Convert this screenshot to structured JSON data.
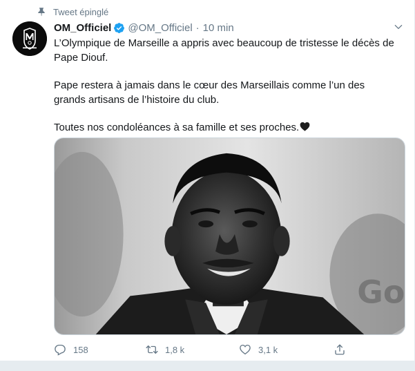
{
  "pinned": {
    "label": "Tweet épinglé",
    "icon": "pin-icon"
  },
  "author": {
    "name": "OM_Officiel",
    "handle": "@OM_Officiel",
    "separator": "·",
    "time": "10 min",
    "verified": true,
    "avatar": "om-logo-avatar"
  },
  "tweet": {
    "paragraphs": [
      "L’Olympique de Marseille a appris avec beaucoup de tristesse le décès de Pape Diouf.",
      "Pape restera à jamais dans le cœur des Marseillais comme l’un des grands artisans de l’histoire du club.",
      "Toutes nos condoléances à sa famille et ses proches."
    ],
    "emoji": "black-heart-icon"
  },
  "media": {
    "type": "photo",
    "style": "black-and-white portrait"
  },
  "actions": {
    "reply_count": "158",
    "retweet_count": "1,8 k",
    "like_count": "3,1 k"
  },
  "colors": {
    "text": "#14171a",
    "secondary": "#657786",
    "verified": "#1da1f2",
    "border": "#e6ecf0"
  }
}
